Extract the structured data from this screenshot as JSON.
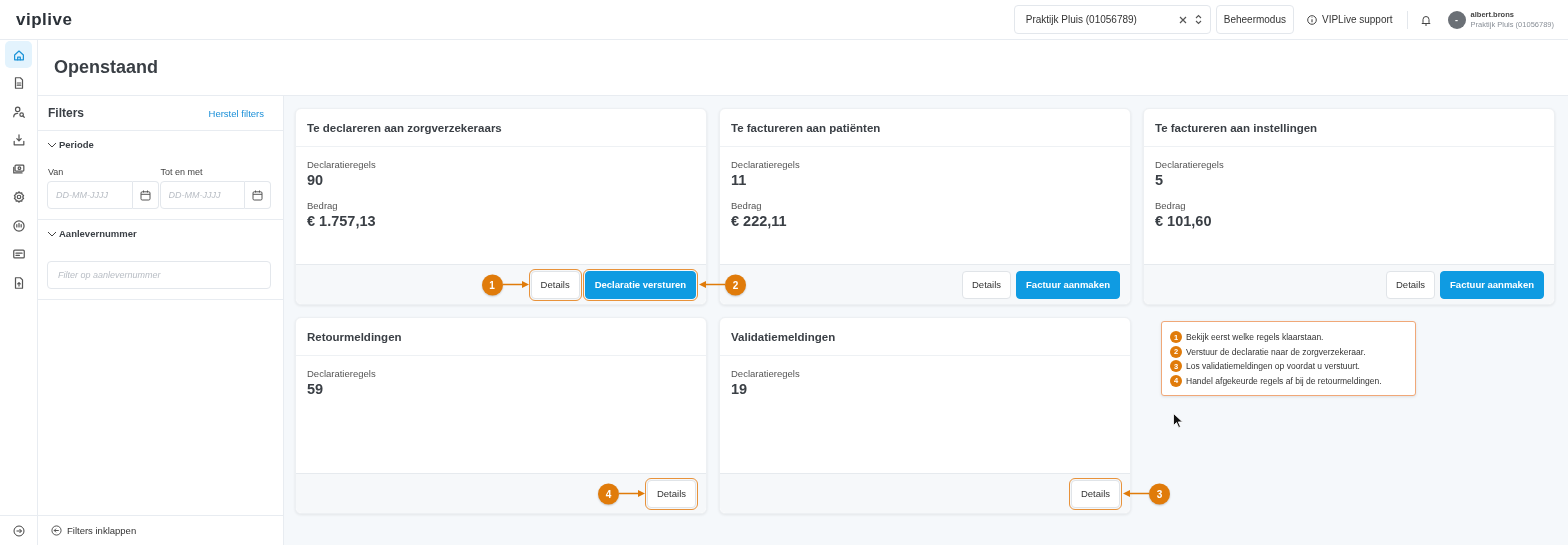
{
  "logo": "viplive",
  "topbar": {
    "practice_select": {
      "value": "Praktijk Pluis (01056789)"
    },
    "mode_button": "Beheermodus",
    "support_link": "VIPLive support",
    "user": {
      "avatar": "-",
      "name": "albert.brons",
      "organization": "Praktijk Pluis (01056789)"
    }
  },
  "nav_items": [
    {
      "kind": "home",
      "selected": true
    },
    {
      "kind": "document",
      "selected": false
    },
    {
      "kind": "user-search",
      "selected": false
    },
    {
      "kind": "download",
      "selected": false
    },
    {
      "kind": "money",
      "selected": false
    },
    {
      "kind": "settings",
      "selected": false
    },
    {
      "kind": "gauge",
      "selected": false
    },
    {
      "kind": "card",
      "selected": false
    },
    {
      "kind": "file-upload",
      "selected": false
    }
  ],
  "page_title": "Openstaand",
  "filters": {
    "title": "Filters",
    "reset_link": "Herstel filters",
    "sections": [
      {
        "title": "Periode",
        "expanded": true,
        "kind": "daterange",
        "fields": [
          {
            "label": "Van",
            "placeholder": "DD-MM-JJJJ"
          },
          {
            "label": "Tot en met",
            "placeholder": "DD-MM-JJJJ"
          }
        ]
      },
      {
        "title": "Aanlevernummer",
        "expanded": true,
        "kind": "text",
        "placeholder": "Filter op aanlevernummer"
      }
    ],
    "collapse_button": "Filters inklappen"
  },
  "cards": [
    {
      "title": "Te declareren aan zorgverzekeraars",
      "stats": [
        {
          "label": "Declaratieregels",
          "value": "90"
        },
        {
          "label": "Bedrag",
          "value": "€ 1.757,13"
        }
      ],
      "buttons": [
        {
          "label": "Details",
          "kind": "secondary",
          "highlighted": true,
          "callout": "1",
          "callout_right": false
        },
        {
          "label": "Declaratie versturen",
          "kind": "primary",
          "highlighted": true,
          "callout": "2",
          "callout_right": true
        }
      ]
    },
    {
      "title": "Te factureren aan patiënten",
      "stats": [
        {
          "label": "Declaratieregels",
          "value": "11"
        },
        {
          "label": "Bedrag",
          "value": "€ 222,11"
        }
      ],
      "buttons": [
        {
          "label": "Details",
          "kind": "secondary",
          "highlighted": false
        },
        {
          "label": "Factuur aanmaken",
          "kind": "primary",
          "highlighted": false
        }
      ]
    },
    {
      "title": "Te factureren aan instellingen",
      "stats": [
        {
          "label": "Declaratieregels",
          "value": "5"
        },
        {
          "label": "Bedrag",
          "value": "€ 101,60"
        }
      ],
      "buttons": [
        {
          "label": "Details",
          "kind": "secondary",
          "highlighted": false
        },
        {
          "label": "Factuur aanmaken",
          "kind": "primary",
          "highlighted": false
        }
      ]
    },
    {
      "title": "Retourmeldingen",
      "stats": [
        {
          "label": "Declaratieregels",
          "value": "59"
        }
      ],
      "buttons": [
        {
          "label": "Details",
          "kind": "secondary",
          "highlighted": true,
          "callout": "4",
          "callout_right": false
        }
      ]
    },
    {
      "title": "Validatiemeldingen",
      "stats": [
        {
          "label": "Declaratieregels",
          "value": "19"
        }
      ],
      "buttons": [
        {
          "label": "Details",
          "kind": "secondary",
          "highlighted": true,
          "callout": "3",
          "callout_right": true
        }
      ]
    }
  ],
  "legend": [
    {
      "number": "1",
      "text": "Bekijk eerst welke regels klaarstaan."
    },
    {
      "number": "2",
      "text": "Verstuur de declaratie naar de zorgverzekeraar."
    },
    {
      "number": "3",
      "text": "Los validatiemeldingen op voordat u verstuurt."
    },
    {
      "number": "4",
      "text": "Handel afgekeurde regels af bij de retourmeldingen."
    }
  ]
}
